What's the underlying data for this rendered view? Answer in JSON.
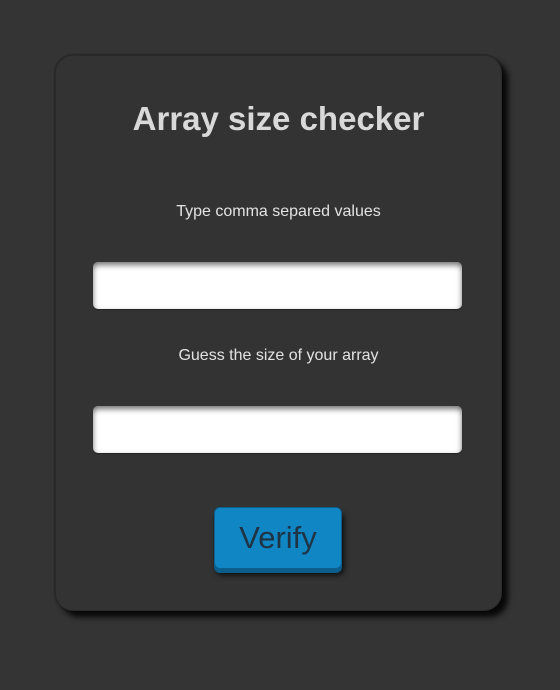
{
  "form": {
    "title": "Array size checker",
    "values_label": "Type comma separed values",
    "values_input": {
      "value": "",
      "placeholder": ""
    },
    "guess_label": "Guess the size of your array",
    "guess_input": {
      "value": "",
      "placeholder": ""
    },
    "verify_label": "Verify"
  },
  "colors": {
    "background": "#343434",
    "card": "#333333",
    "button": "#1186c4",
    "button_text": "#1e3344"
  }
}
